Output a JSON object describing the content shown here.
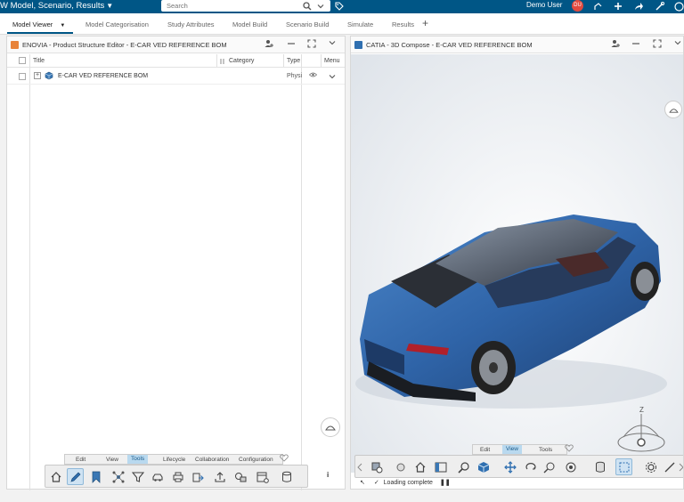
{
  "topbar": {
    "title": "W Model, Scenario, Results",
    "search_placeholder": "Search",
    "user_name": "Demo User"
  },
  "tabs": [
    {
      "label": "Model Viewer",
      "active": true
    },
    {
      "label": "Model Categorisation"
    },
    {
      "label": "Study Attributes"
    },
    {
      "label": "Model Build"
    },
    {
      "label": "Scenario Build"
    },
    {
      "label": "Simulate"
    },
    {
      "label": "Results"
    }
  ],
  "left_panel": {
    "title": "ENOVIA - Product Structure Editor - E-CAR VED REFERENCE BOM",
    "columns": {
      "title": "Title",
      "category": "Category",
      "type": "Type",
      "menu": "Menu"
    },
    "row": {
      "title": "E-CAR VED REFERENCE BOM",
      "type": "Physi"
    },
    "tool_tabs": [
      "Edit",
      "View",
      "Tools",
      "Lifecycle",
      "Collaboration",
      "Configuration"
    ],
    "active_tool_tab": "Tools"
  },
  "right_panel": {
    "title": "CATIA - 3D Compose - E-CAR VED REFERENCE BOM",
    "tool_tabs": [
      "Edit",
      "View",
      "Tools"
    ],
    "active_tool_tab": "View",
    "status": "Loading complete",
    "compass_label": "Z"
  },
  "colors": {
    "topbar": "#005686",
    "car_body": "#2f64a8",
    "accent": "#e04a3f"
  }
}
